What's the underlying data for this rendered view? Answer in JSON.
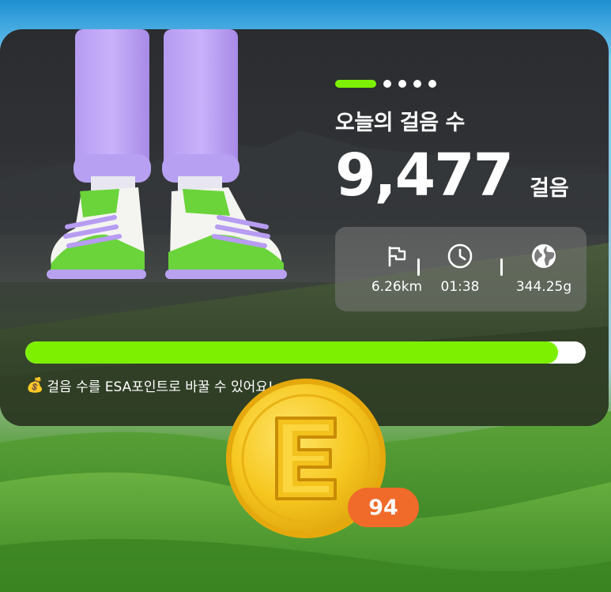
{
  "colors": {
    "accent": "#7cf000",
    "badge": "#f06a2a",
    "card_bg": "#2f3134",
    "stats_bg": "#787878",
    "coin": "#f2c21b"
  },
  "pager": {
    "count": 5,
    "active_index": 0
  },
  "title": "오늘의 걸음 수",
  "steps": {
    "value": "9,477",
    "unit": "걸음"
  },
  "stats": [
    {
      "icon": "flag-icon",
      "value": "6.26km"
    },
    {
      "icon": "clock-icon",
      "value": "01:38"
    },
    {
      "icon": "globe-icon",
      "value": "344.25g"
    }
  ],
  "progress": {
    "fraction": 0.95
  },
  "hint": {
    "icon": "money-bag-icon",
    "text": "걸음 수를 ESA포인트로 바꿀 수 있어요!"
  },
  "coin": {
    "letter": "E",
    "badge": "94"
  }
}
